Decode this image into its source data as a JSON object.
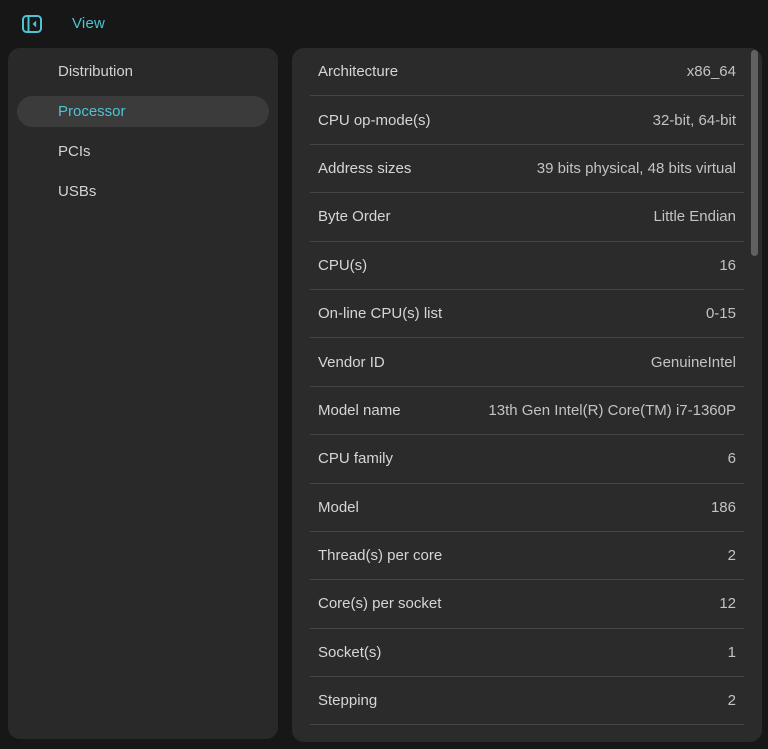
{
  "colors": {
    "window_bg": "#171717",
    "panel_bg": "#292929",
    "details_bg": "#2b2b2b",
    "accent": "#4dc3d6",
    "selected_pill_bg": "#3b3b3b",
    "divider": "#454545",
    "label_text": "#d6d6d6",
    "value_text": "#c3c3c3",
    "scroll_thumb": "#616161"
  },
  "topbar": {
    "sidebar_toggle_icon": "sidebar-collapse-icon",
    "menu_view_label": "View"
  },
  "sidebar": {
    "items": [
      {
        "label": "Distribution",
        "selected": false
      },
      {
        "label": "Processor",
        "selected": true
      },
      {
        "label": "PCIs",
        "selected": false
      },
      {
        "label": "USBs",
        "selected": false
      }
    ]
  },
  "details": {
    "rows": [
      {
        "label": "Architecture",
        "value": "x86_64"
      },
      {
        "label": "CPU op-mode(s)",
        "value": "32-bit, 64-bit"
      },
      {
        "label": "Address sizes",
        "value": "39 bits physical, 48 bits virtual"
      },
      {
        "label": "Byte Order",
        "value": "Little Endian"
      },
      {
        "label": "CPU(s)",
        "value": "16"
      },
      {
        "label": "On-line CPU(s) list",
        "value": "0-15"
      },
      {
        "label": "Vendor ID",
        "value": "GenuineIntel"
      },
      {
        "label": "Model name",
        "value": "13th Gen Intel(R) Core(TM) i7-1360P"
      },
      {
        "label": "CPU family",
        "value": "6"
      },
      {
        "label": "Model",
        "value": "186"
      },
      {
        "label": "Thread(s) per core",
        "value": "2"
      },
      {
        "label": "Core(s) per socket",
        "value": "12"
      },
      {
        "label": "Socket(s)",
        "value": "1"
      },
      {
        "label": "Stepping",
        "value": "2"
      }
    ]
  }
}
